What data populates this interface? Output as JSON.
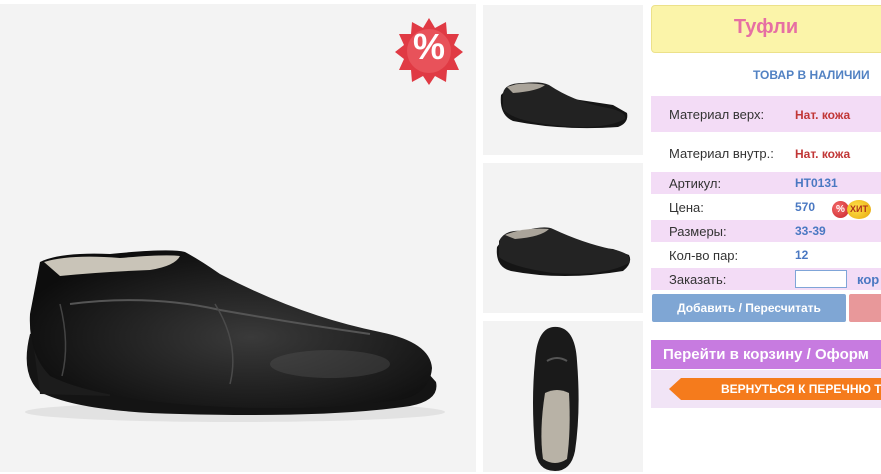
{
  "product": {
    "title": "Туфли",
    "stock_status": "ТОВАР В НАЛИЧИИ",
    "sale_badge": "%",
    "main_image_icon": "black-leather-loafer-photo",
    "thumbnails": [
      {
        "icon": "loafer-side-view-photo"
      },
      {
        "icon": "loafer-side-view-photo"
      },
      {
        "icon": "loafer-top-view-photo"
      }
    ]
  },
  "specs": {
    "material_top_label": "Материал верх:",
    "material_top_value": "Нат. кожа",
    "material_inner_label": "Материал внутр.:",
    "material_inner_value": "Нат. кожа",
    "article_label": "Артикул:",
    "article_value": "НТ0131",
    "price_label": "Цена:",
    "price_value": "570",
    "price_badge_pct": "%",
    "price_badge_hit": "ХИТ",
    "sizes_label": "Размеры:",
    "sizes_value": "33-39",
    "pairs_label": "Кол-во пар:",
    "pairs_value": "12",
    "order_label": "Заказать:",
    "order_input_value": "",
    "order_unit": "кор"
  },
  "actions": {
    "add_label": "Добавить / Пересчитать",
    "checkout_label": "Перейти в корзину / Оформ",
    "back_label": "ВЕРНУТЬСЯ К ПЕРЕЧНЮ ТО"
  },
  "colors": {
    "title_bg": "#fbf4a9",
    "title_text": "#e66fa3",
    "row_pink": "#f3dcf6",
    "value_red": "#c13636",
    "value_blue": "#4a78c2",
    "add_button": "#7fa6d4",
    "checkout_bar": "#c77be0",
    "back_button": "#f57b1c"
  }
}
